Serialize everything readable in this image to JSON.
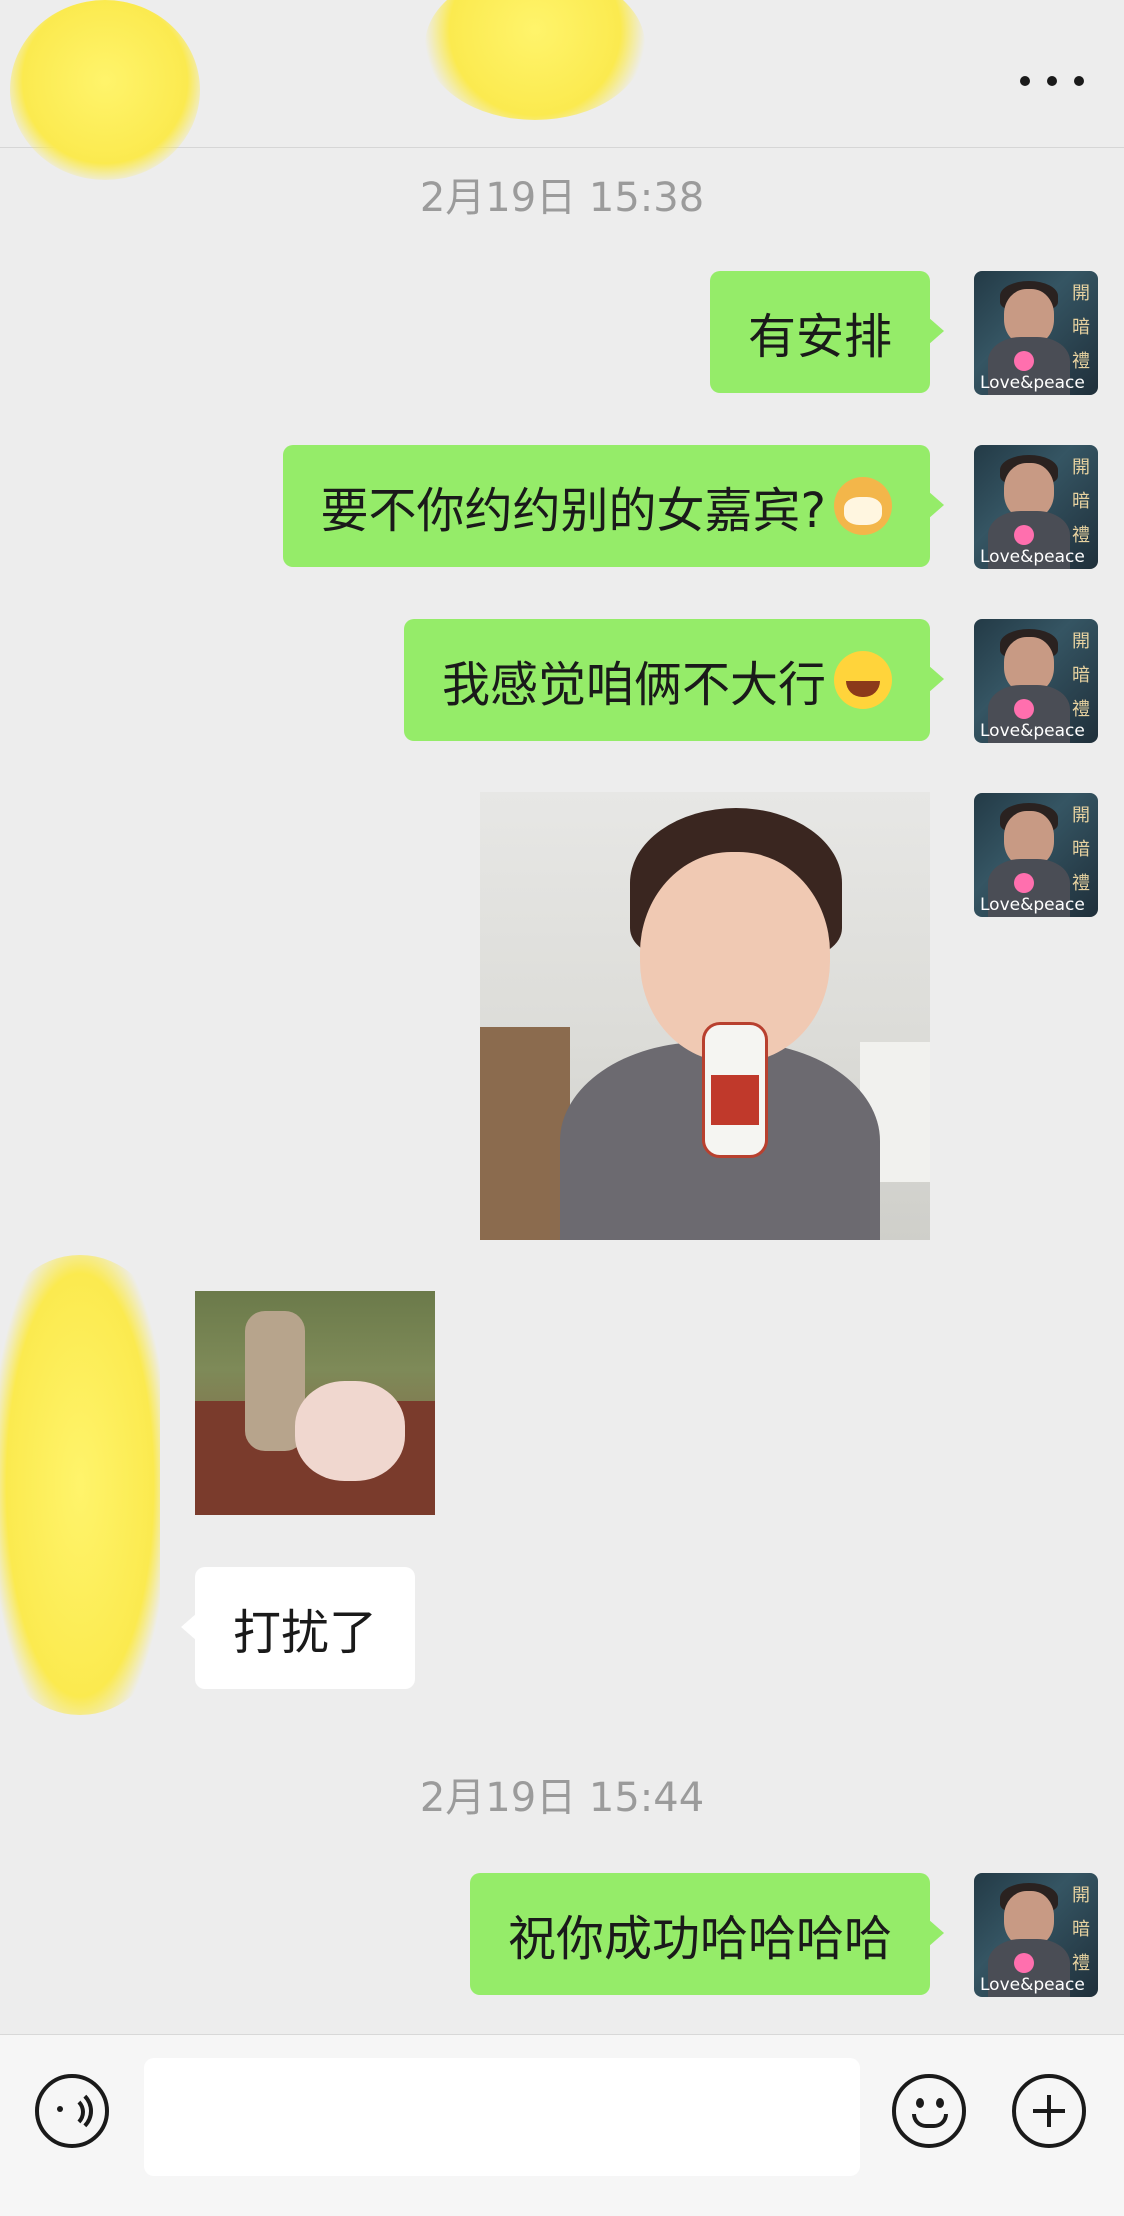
{
  "header": {
    "more_icon": "more-dots-icon"
  },
  "messages": [
    {
      "type": "timestamp",
      "text": "2月19日 15:38"
    },
    {
      "type": "out",
      "text": "有安排"
    },
    {
      "type": "out",
      "text": "要不你约约别的女嘉宾?",
      "emoji": "cat-face-emoji"
    },
    {
      "type": "out",
      "text": "我感觉咱俩不大行",
      "emoji": "laughing-tears-emoji"
    },
    {
      "type": "out-image",
      "image": "girl-with-bottle-sticker"
    },
    {
      "type": "in-image",
      "image": "man-with-pig-photo"
    },
    {
      "type": "in",
      "text": "打扰了"
    },
    {
      "type": "timestamp",
      "text": "2月19日 15:44"
    },
    {
      "type": "out",
      "text": "祝你成功哈哈哈哈"
    }
  ],
  "avatar": {
    "caption": "Love&peace",
    "chars": "開 暗 禮"
  },
  "input_bar": {
    "placeholder": "",
    "voice_icon": "voice-icon",
    "emoji_icon": "smiley-icon",
    "plus_icon": "plus-icon"
  },
  "colors": {
    "background": "#ededed",
    "outgoing_bubble": "#95ec69",
    "incoming_bubble": "#ffffff",
    "timestamp": "#9b9b9b"
  }
}
